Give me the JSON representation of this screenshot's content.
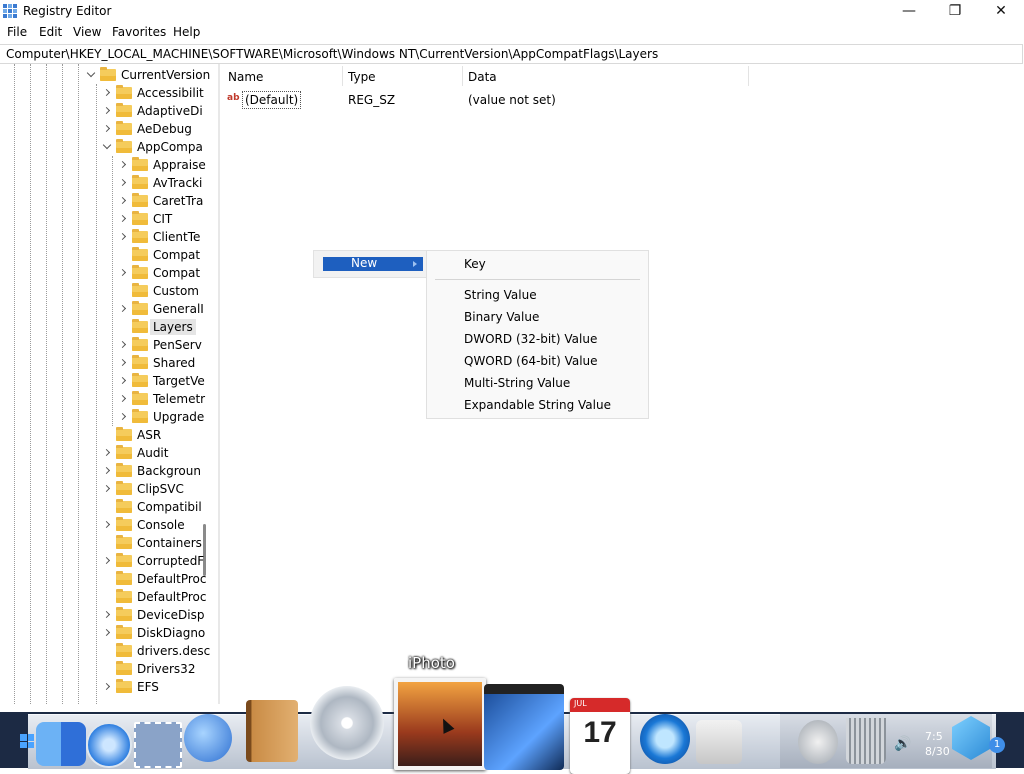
{
  "window": {
    "title": "Registry Editor"
  },
  "window_controls": {
    "minimize": "—",
    "maximize": "❐",
    "close": "✕"
  },
  "menu": [
    "File",
    "Edit",
    "View",
    "Favorites",
    "Help"
  ],
  "address": "Computer\\HKEY_LOCAL_MACHINE\\SOFTWARE\\Microsoft\\Windows NT\\CurrentVersion\\AppCompatFlags\\Layers",
  "tree": [
    {
      "label": "CurrentVersion",
      "expander": "down"
    },
    {
      "label": "Accessibilit",
      "expander": "right"
    },
    {
      "label": "AdaptiveDi",
      "expander": "right"
    },
    {
      "label": "AeDebug",
      "expander": "right"
    },
    {
      "label": "AppCompa",
      "expander": "down"
    },
    {
      "label": "Appraise",
      "expander": "right"
    },
    {
      "label": "AvTracki",
      "expander": "right"
    },
    {
      "label": "CaretTra",
      "expander": "right"
    },
    {
      "label": "CIT",
      "expander": "right"
    },
    {
      "label": "ClientTe",
      "expander": "right"
    },
    {
      "label": "Compat",
      "expander": "none"
    },
    {
      "label": "Compat",
      "expander": "right"
    },
    {
      "label": "Custom",
      "expander": "none"
    },
    {
      "label": "GeneralI",
      "expander": "right"
    },
    {
      "label": "Layers",
      "expander": "none",
      "selected": true
    },
    {
      "label": "PenServ",
      "expander": "right"
    },
    {
      "label": "Shared",
      "expander": "right"
    },
    {
      "label": "TargetVe",
      "expander": "right"
    },
    {
      "label": "Telemetr",
      "expander": "right"
    },
    {
      "label": "Upgrade",
      "expander": "right"
    },
    {
      "label": "ASR",
      "expander": "none"
    },
    {
      "label": "Audit",
      "expander": "right"
    },
    {
      "label": "Backgroun",
      "expander": "right"
    },
    {
      "label": "ClipSVC",
      "expander": "right"
    },
    {
      "label": "Compatibil",
      "expander": "none"
    },
    {
      "label": "Console",
      "expander": "right"
    },
    {
      "label": "Containers",
      "expander": "none"
    },
    {
      "label": "CorruptedF",
      "expander": "right"
    },
    {
      "label": "DefaultProc",
      "expander": "none"
    },
    {
      "label": "DefaultProc",
      "expander": "none"
    },
    {
      "label": "DeviceDisp",
      "expander": "right"
    },
    {
      "label": "DiskDiagno",
      "expander": "right"
    },
    {
      "label": "drivers.desc",
      "expander": "none"
    },
    {
      "label": "Drivers32",
      "expander": "none"
    },
    {
      "label": "EFS",
      "expander": "right"
    }
  ],
  "list": {
    "columns": [
      "Name",
      "Type",
      "Data"
    ],
    "rows": [
      {
        "icon": "ab",
        "name": "(Default)",
        "type": "REG_SZ",
        "data": "(value not set)"
      }
    ]
  },
  "context_menu": {
    "new_label": "New",
    "submenu": [
      "Key",
      "String Value",
      "Binary Value",
      "DWORD (32-bit) Value",
      "QWORD (64-bit) Value",
      "Multi-String Value",
      "Expandable String Value"
    ]
  },
  "dock": {
    "tooltip": "iPhoto",
    "calendar_month": "JUL",
    "calendar_day": "17",
    "clock_time": "7:5",
    "clock_date": "8/30",
    "notification": "1",
    "volume_icon": "🔊"
  }
}
